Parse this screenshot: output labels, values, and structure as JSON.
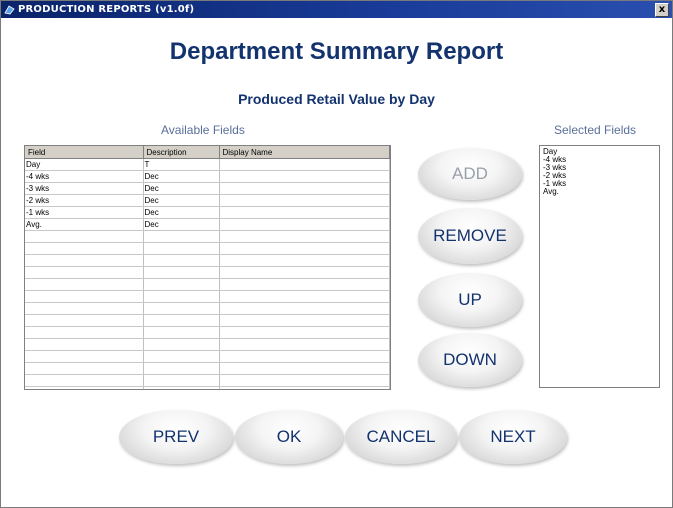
{
  "window": {
    "title": "PRODUCTION REPORTS (v1.0f)",
    "close_label": "x"
  },
  "header": {
    "title": "Department Summary Report",
    "subtitle": "Produced Retail Value by Day"
  },
  "available": {
    "label": "Available Fields",
    "columns": [
      "Field",
      "Description",
      "Display Name"
    ],
    "rows": [
      [
        "Day",
        "T",
        ""
      ],
      [
        "-4 wks",
        "Dec",
        ""
      ],
      [
        "-3 wks",
        "Dec",
        ""
      ],
      [
        "-2 wks",
        "Dec",
        ""
      ],
      [
        "-1 wks",
        "Dec",
        ""
      ],
      [
        "Avg.",
        "Dec",
        ""
      ],
      [
        "",
        "",
        ""
      ],
      [
        "",
        "",
        ""
      ],
      [
        "",
        "",
        ""
      ],
      [
        "",
        "",
        ""
      ],
      [
        "",
        "",
        ""
      ],
      [
        "",
        "",
        ""
      ],
      [
        "",
        "",
        ""
      ],
      [
        "",
        "",
        ""
      ],
      [
        "",
        "",
        ""
      ],
      [
        "",
        "",
        ""
      ],
      [
        "",
        "",
        ""
      ],
      [
        "",
        "",
        ""
      ],
      [
        "",
        "",
        ""
      ],
      [
        "",
        "",
        ""
      ]
    ]
  },
  "selected": {
    "label": "Selected Fields",
    "items": [
      "Day",
      "-4 wks",
      "-3 wks",
      "-2 wks",
      "-1 wks",
      "Avg."
    ]
  },
  "actions": {
    "add": "ADD",
    "remove": "REMOVE",
    "up": "UP",
    "down": "DOWN"
  },
  "nav": {
    "prev": "PREV",
    "ok": "OK",
    "cancel": "CANCEL",
    "next": "NEXT"
  },
  "colors": {
    "title_blue": "#13336e",
    "titlebar": "#0a246a"
  }
}
